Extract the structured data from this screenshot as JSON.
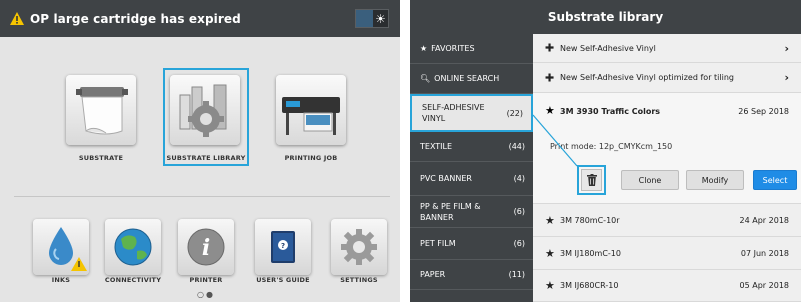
{
  "left_panel": {
    "alert_title": "OP large cartridge has expired",
    "top_tiles": [
      {
        "label": "SUBSTRATE"
      },
      {
        "label": "SUBSTRATE LIBRARY"
      },
      {
        "label": "PRINTING JOB"
      }
    ],
    "bottom_tiles": [
      {
        "label": "INKS"
      },
      {
        "label": "CONNECTIVITY"
      },
      {
        "label": "PRINTER"
      },
      {
        "label": "USER'S GUIDE"
      },
      {
        "label": "SETTINGS"
      }
    ],
    "page_dots": "○●"
  },
  "right_panel": {
    "title": "Substrate library",
    "sidebar": [
      {
        "label": "FAVORITES",
        "count": ""
      },
      {
        "label": "ONLINE SEARCH",
        "count": ""
      },
      {
        "label": "SELF-ADHESIVE VINYL",
        "count": "(22)"
      },
      {
        "label": "TEXTILE",
        "count": "(44)"
      },
      {
        "label": "PVC BANNER",
        "count": "(4)"
      },
      {
        "label": "PP & PE FILM & BANNER",
        "count": "(6)"
      },
      {
        "label": "PET FILM",
        "count": "(6)"
      },
      {
        "label": "PAPER",
        "count": "(11)"
      }
    ],
    "new_items": [
      {
        "label": "New Self-Adhesive Vinyl"
      },
      {
        "label": "New Self-Adhesive Vinyl optimized for tiling"
      }
    ],
    "selected_item": {
      "name": "3M 3930 Traffic Colors",
      "date": "26 Sep 2018",
      "print_mode": "Print mode: 12p_CMYKcm_150",
      "clone": "Clone",
      "modify": "Modify",
      "select": "Select"
    },
    "items": [
      {
        "name": "3M 780mC-10r",
        "date": "24 Apr 2018"
      },
      {
        "name": "3M IJ180mC-10",
        "date": "07 Jun 2018"
      },
      {
        "name": "3M IJ680CR-10",
        "date": "05 Apr 2018"
      }
    ]
  },
  "colors": {
    "accent_blue": "#28a4d9",
    "select_button": "#1f8ce6",
    "dark_bar": "#3f4346",
    "warning_yellow": "#f5c400"
  }
}
